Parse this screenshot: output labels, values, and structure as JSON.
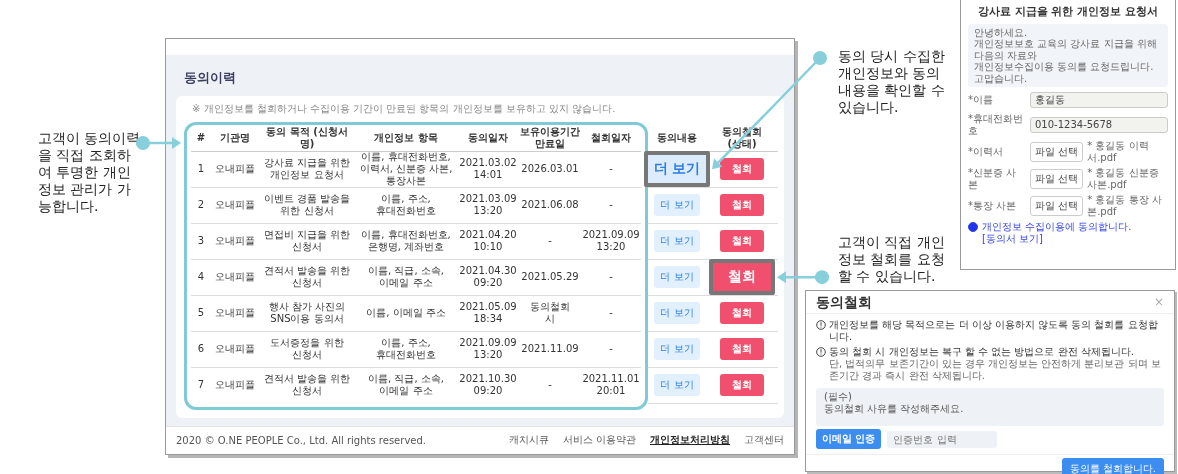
{
  "history": {
    "title": "동의이력",
    "notice": "※ 개인정보를 철회하거나 수집이용 기간이 만료된 항목의 개인정보를 보유하고 있지 않습니다.",
    "columns": [
      "#",
      "기관명",
      "동의 목적 (신청서 명)",
      "개인정보 항목",
      "동의일자",
      "보유이용기간 만료일",
      "철회일자",
      "동의내용",
      "동의철회(상태)"
    ],
    "rows": [
      {
        "no": "1",
        "org": "오내피플",
        "purpose": "강사료 지급을 위한 개인정보 요청서",
        "items": "이름, 휴대전화번호, 이력서, 신분증 사본, 통장사본",
        "consent_date": "2021.03.02 14:01",
        "expiry": "2026.03.01",
        "withdrawn": "-",
        "view_button": {
          "label": "더 보기",
          "zoomed": true
        },
        "withdraw_button": {
          "label": "철회",
          "zoomed": false
        }
      },
      {
        "no": "2",
        "org": "오내피플",
        "purpose": "이벤트 경품 발송을 위한 신청서",
        "items": "이름, 주소, 휴대전화번호",
        "consent_date": "2021.03.09 13:20",
        "expiry": "2021.06.08",
        "withdrawn": "-",
        "view_button": {
          "label": "더 보기",
          "zoomed": false
        },
        "withdraw_button": {
          "label": "철회",
          "zoomed": false
        }
      },
      {
        "no": "3",
        "org": "오내피플",
        "purpose": "면접비 지급을 위한 신청서",
        "items": "이름, 휴대전화번호, 은행명, 계좌번호",
        "consent_date": "2021.04.20 10:10",
        "expiry": "-",
        "withdrawn": "2021.09.09 13:20",
        "view_button": {
          "label": "더 보기",
          "zoomed": false
        },
        "withdraw_button": {
          "label": "철회",
          "zoomed": false
        }
      },
      {
        "no": "4",
        "org": "오내피플",
        "purpose": "견적서 발송을 위한 신청서",
        "items": "이름, 직급, 소속, 이메일 주소",
        "consent_date": "2021.04.30 09:20",
        "expiry": "2021.05.29",
        "withdrawn": "-",
        "view_button": {
          "label": "더 보기",
          "zoomed": false
        },
        "withdraw_button": {
          "label": "철회",
          "zoomed": true
        }
      },
      {
        "no": "5",
        "org": "오내피플",
        "purpose": "행사 참가 사진의 SNS이용 동의서",
        "items": "이름, 이메일 주소",
        "consent_date": "2021.05.09 18:34",
        "expiry": "동의철회 시",
        "withdrawn": "-",
        "view_button": {
          "label": "더 보기",
          "zoomed": false
        },
        "withdraw_button": {
          "label": "철회",
          "zoomed": false
        }
      },
      {
        "no": "6",
        "org": "오내피플",
        "purpose": "도서증정을 위한 신청서",
        "items": "이름, 주소, 휴대전화번호",
        "consent_date": "2021.09.09 13:20",
        "expiry": "2021.11.09",
        "withdrawn": "-",
        "view_button": {
          "label": "더 보기",
          "zoomed": false
        },
        "withdraw_button": {
          "label": "철회",
          "zoomed": false
        }
      },
      {
        "no": "7",
        "org": "오내피플",
        "purpose": "견적서 발송을 위한 신청서",
        "items": "이름, 직급, 소속, 이메일 주소",
        "consent_date": "2021.10.30 09:20",
        "expiry": "-",
        "withdrawn": "2021.11.01 20:01",
        "view_button": {
          "label": "더 보기",
          "zoomed": false
        },
        "withdraw_button": {
          "label": "철회",
          "zoomed": false
        }
      }
    ],
    "footer": {
      "copyright": "2020 © O.NE PEOPLE Co., Ltd. All rights reserved.",
      "links": [
        {
          "label": "캐치시큐",
          "emphasized": false
        },
        {
          "label": "서비스 이용약관",
          "emphasized": false
        },
        {
          "label": "개인정보처리방침",
          "emphasized": true
        },
        {
          "label": "고객센터",
          "emphasized": false
        }
      ]
    }
  },
  "request_form": {
    "title": "강사료 지급을 위한 개인정보 요청서",
    "greeting_lines": [
      "안녕하세요.",
      "개인정보보호 교육의 강사료 지급을 위해 다음의 자료와",
      "개인정보수집이용 동의를 요청드립니다.",
      "고맙습니다."
    ],
    "fields": [
      {
        "kind": "text",
        "label": "*이름",
        "value": "홍길동"
      },
      {
        "kind": "text",
        "label": "*휴대전화번호",
        "value": "010-1234-5678"
      },
      {
        "kind": "file",
        "label": "*이력서",
        "button": "파일 선택",
        "file": "* 홍길동 이력서.pdf"
      },
      {
        "kind": "file",
        "label": "*신분증 사본",
        "button": "파일 선택",
        "file": "* 홍길동 신분증 사본.pdf"
      },
      {
        "kind": "file",
        "label": "*통장 사본",
        "button": "파일 선택",
        "file": "* 홍길동 통장 사본.pdf"
      }
    ],
    "agree": {
      "label": "개인정보 수집이용에 동의합니다.",
      "link": "[동의서 보기]",
      "checked": true
    }
  },
  "withdraw_modal": {
    "title": "동의철회",
    "close": "×",
    "notices": [
      {
        "text": "개인정보를 해당 목적으로는 더 이상 이용하지 않도록 동의 철회를 요청합니다."
      },
      {
        "text": "동의 철회 시 개인정보는 복구 할 수 없는 방법으로 완전 삭제됩니다.",
        "note": "단, 법적의무 보존기간이 있는 경우 개인정보는 안전하게 분리보관 되며 보존기간 경과 즉시 완전 삭제됩니다."
      }
    ],
    "reason": {
      "placeholder": "(필수)\n동의철회 사유를 작성해주세요."
    },
    "email_button": "이메일 인증",
    "code": {
      "placeholder": "인증번호 입력"
    },
    "submit": "동의를 철회합니다."
  },
  "callouts": [
    {
      "text": "고객이 동의이력을 직접 조회하여 투명한 개인정보 관리가 가능합니다."
    },
    {
      "text": "동의 당시 수집한 개인정보와 동의내용을 확인할 수 있습니다."
    },
    {
      "text": "고객이 직접 개인정보 철회를 요청 할 수 있습니다."
    }
  ]
}
